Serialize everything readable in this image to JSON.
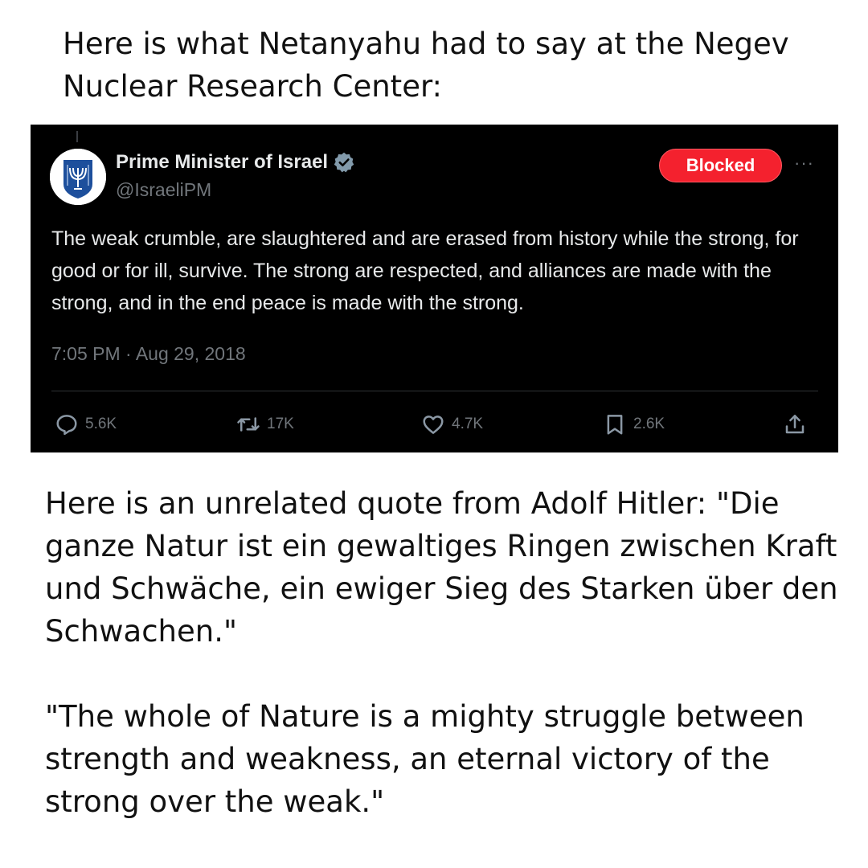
{
  "intro": "Here is what Netanyahu had to say at the Negev Nuclear Research Center:",
  "tweet": {
    "author_name": "Prime Minister of Israel",
    "handle": "@IsraeliPM",
    "blocked_label": "Blocked",
    "more_label": "···",
    "text": "The weak crumble, are slaughtered and are erased from history while the strong, for good or for ill, survive. The strong are respected, and alliances are made with the strong, and in the end peace is made with the strong.",
    "timestamp": "7:05 PM · Aug 29, 2018",
    "replies": "5.6K",
    "reposts": "17K",
    "likes": "4.7K",
    "bookmarks": "2.6K",
    "avatar_icon": "menorah-emblem-icon",
    "verified_icon": "verified-badge-icon",
    "colors": {
      "blocked": "#f4212e",
      "verified": "#829aab",
      "muted": "#71767b"
    }
  },
  "quote": {
    "hitler_quote": "Here is an unrelated quote from Adolf Hitler: \"Die ganze Natur ist ein gewaltiges Ringen zwischen Kraft und Schwäche, ein ewiger Sieg des Starken über den Schwachen.\"",
    "translation": "\"The whole of Nature is a mighty struggle between strength and weakness, an eternal victory of the strong over the weak.\""
  }
}
